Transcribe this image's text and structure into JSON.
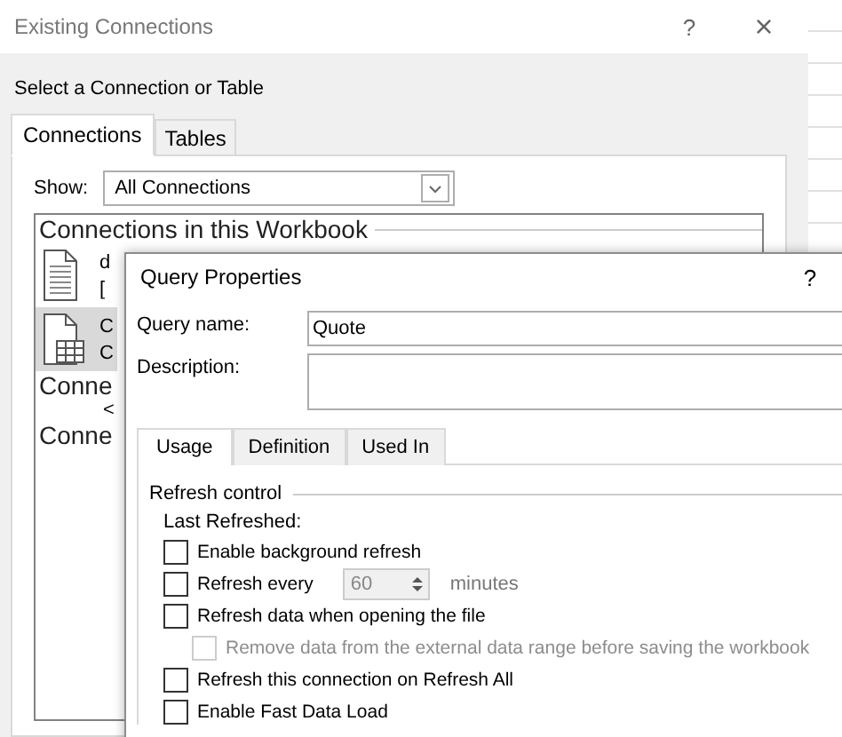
{
  "back_window": {
    "title": "Existing Connections",
    "help": "?",
    "close": "×",
    "heading": "Select a Connection or Table",
    "tabs": [
      {
        "label": "Connections",
        "selected": true
      },
      {
        "label": "Tables",
        "selected": false
      }
    ],
    "show": {
      "label": "Show:",
      "value": "All Connections"
    },
    "sections": [
      {
        "title": "Connections in this Workbook",
        "items": [
          {
            "kind": "file",
            "name": "d",
            "detail": "[",
            "selected": false
          },
          {
            "kind": "table",
            "name": "C",
            "detail": "C",
            "selected": true
          }
        ]
      },
      {
        "title": "Conne",
        "items": [
          {
            "kind": "message",
            "name": "<"
          }
        ]
      },
      {
        "title": "Conne"
      }
    ]
  },
  "query_dialog": {
    "title": "Query Properties",
    "help": "?",
    "fields": [
      {
        "label": "Query name:",
        "value": "Quote",
        "kind": "line"
      },
      {
        "label": "Description:",
        "kind": "area"
      }
    ],
    "tabs": [
      {
        "label": "Usage",
        "selected": true
      },
      {
        "label": "Definition",
        "selected": false
      },
      {
        "label": "Used In",
        "selected": false
      }
    ],
    "group": "Refresh control",
    "last_refreshed": "Last Refreshed:",
    "options": [
      {
        "kind": "check",
        "label": "Enable background refresh",
        "checked": false,
        "disabled": false
      },
      {
        "kind": "interval",
        "label": "Refresh every",
        "checked": false,
        "disabled": false,
        "value": "60",
        "unit": "minutes"
      },
      {
        "kind": "check",
        "label": "Refresh data when opening the file",
        "checked": false,
        "disabled": false
      },
      {
        "kind": "subcheck",
        "label": "Remove data from the external data range before saving the workbook",
        "checked": false,
        "disabled": true
      },
      {
        "kind": "check",
        "label": "Refresh this connection on Refresh All",
        "checked": false,
        "disabled": false
      },
      {
        "kind": "check",
        "label": "Enable Fast Data Load",
        "checked": false,
        "disabled": false
      }
    ]
  }
}
